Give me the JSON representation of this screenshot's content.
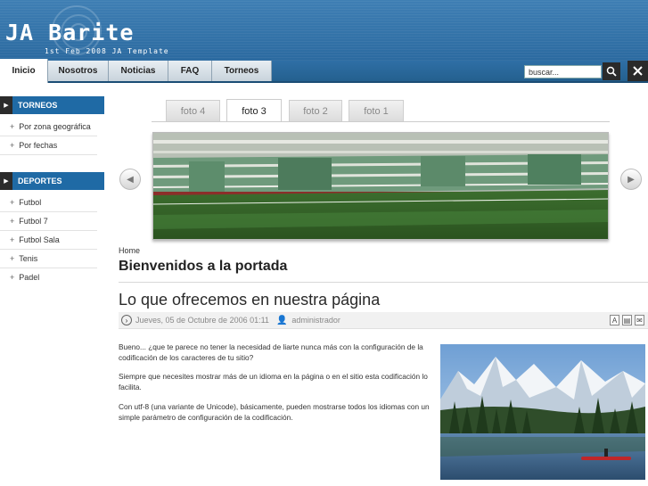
{
  "header": {
    "logo": "JA Barite",
    "tagline": "1st Feb 2008 JA Template"
  },
  "nav": {
    "tabs": [
      "Inicio",
      "Nosotros",
      "Noticias",
      "FAQ",
      "Torneos"
    ],
    "active_tab": "Inicio",
    "search_placeholder": "buscar..."
  },
  "sidebar": {
    "sections": [
      {
        "title": "TORNEOS",
        "items": [
          "Por zona geográfica",
          "Por fechas"
        ]
      },
      {
        "title": "DEPORTES",
        "items": [
          "Futbol",
          "Futbol 7",
          "Futbol Sala",
          "Tenis",
          "Padel"
        ]
      }
    ]
  },
  "gallery": {
    "tabs": [
      "foto 4",
      "foto 3",
      "foto 2",
      "foto 1"
    ],
    "active_tab": "foto 3"
  },
  "content": {
    "breadcrumb": "Home",
    "page_title": "Bienvenidos a la portada",
    "article": {
      "title": "Lo que ofrecemos en nuestra página",
      "date": "Jueves, 05 de Octubre de 2006 01:11",
      "author": "administrador",
      "paragraphs": [
        "Bueno... ¿que te parece no tener la necesidad de liarte nunca más con la configuración de la codificación de los caracteres de tu sitio?",
        "Siempre que necesites mostrar más de un idioma en la página o en el sitio esta codificación lo facilita.",
        "Con utf-8 (una variante de Unicode), básicamente, pueden mostrarse todos los idiomas con un simple parámetro de configuración de la codificación."
      ]
    }
  },
  "colors": {
    "header_blue": "#2b6aa0",
    "sidebar_head": "#1f6aa5"
  },
  "icons": {
    "search": "magnifier-icon",
    "tools": "tools-icon",
    "prev": "prev-arrow-icon",
    "next": "next-arrow-icon",
    "date": "clock-icon",
    "author": "user-icon",
    "pdf": "pdf-icon",
    "print": "print-icon",
    "email": "email-icon"
  }
}
